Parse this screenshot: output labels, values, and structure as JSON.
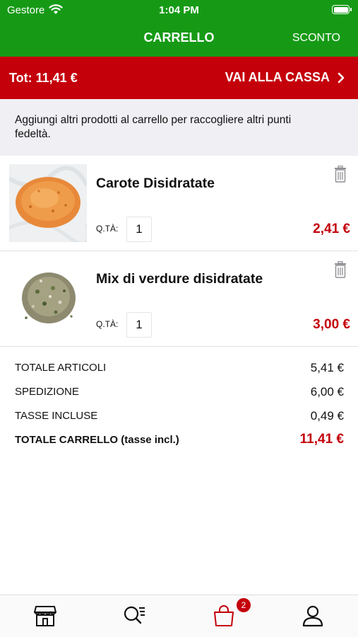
{
  "status_bar": {
    "carrier": "Gestore",
    "time": "1:04 PM"
  },
  "nav": {
    "title": "CARRELLO",
    "right_action": "SCONTO"
  },
  "total_bar": {
    "total": "Tot: 11,41 €",
    "checkout": "VAI ALLA CASSA"
  },
  "notice": {
    "text": "Aggiungi altri prodotti al carrello per raccogliere altri punti fedeltà."
  },
  "cart": {
    "items": [
      {
        "name": "Carote Disidratate",
        "qty_label": "Q.TÀ:",
        "qty": "1",
        "price": "2,41 €"
      },
      {
        "name": "Mix di verdure disidratate",
        "qty_label": "Q.TÀ:",
        "qty": "1",
        "price": "3,00 €"
      }
    ]
  },
  "summary": {
    "articles_label": "TOTALE ARTICOLI",
    "articles_value": "5,41 €",
    "shipping_label": "SPEDIZIONE",
    "shipping_value": "6,00 €",
    "taxes_label": "TASSE INCLUSE",
    "taxes_value": "0,49 €",
    "total_label": "TOTALE CARRELLO (tasse incl.)",
    "total_value": "11,41 €"
  },
  "tab_bar": {
    "tabs": [
      {
        "icon": "store-icon",
        "active": false
      },
      {
        "icon": "search-list-icon",
        "active": false
      },
      {
        "icon": "bag-icon",
        "active": true
      },
      {
        "icon": "user-icon",
        "active": false
      }
    ],
    "cart_badge": "2"
  },
  "colors": {
    "green": "#169a16",
    "red": "#c4000b",
    "notice_bg": "#efeff4"
  }
}
